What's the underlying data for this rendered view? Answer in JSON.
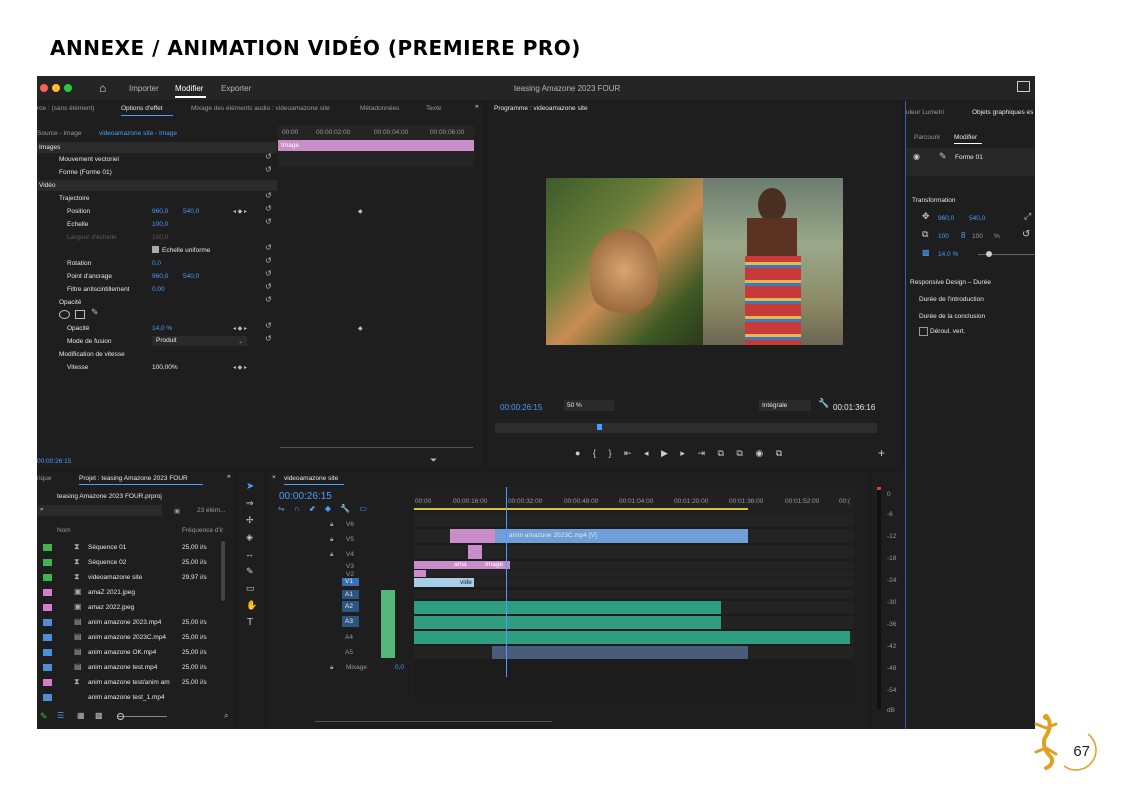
{
  "page": {
    "heading": "ANNEXE / ANIMATION VIDÉO (PREMIERE PRO)",
    "page_number": "67"
  },
  "app": {
    "title": "teasing Amazone 2023 FOUR",
    "menu": [
      "Importer",
      "Modifier",
      "Exporter"
    ],
    "active_menu": "Modifier"
  },
  "source_panel": {
    "tabs": [
      "rce : (sans élément)",
      "Options d'effet",
      "Mixage des éléments audio : videoamazone site",
      "Métadonnées",
      "Texte"
    ],
    "active_tab": "Options d'effet",
    "source_label": "Source - Image",
    "sequence_label": "videoamazone site - Image",
    "ruler": [
      "00:00",
      "00:00:02:00",
      "00:00:04:00",
      "00:00:06:00"
    ],
    "clip_label": "Image",
    "section_images": "Images",
    "section_video": "Vidéo",
    "rows": [
      {
        "label": "Mouvement vectoriel"
      },
      {
        "label": "Forme (Forme 01)"
      },
      {
        "label": "Trajectoire"
      },
      {
        "label": "Position",
        "v1": "960,0",
        "v2": "540,0"
      },
      {
        "label": "Echelle",
        "v1": "100,0"
      },
      {
        "label": "Largeur d'échelle",
        "v1": "100,0"
      },
      {
        "label": "Echelle uniforme"
      },
      {
        "label": "Rotation",
        "v1": "0,0"
      },
      {
        "label": "Point d'ancrage",
        "v1": "960,0",
        "v2": "540,0"
      },
      {
        "label": "Filtre antiscintillement",
        "v1": "0,00"
      },
      {
        "label": "Opacité"
      },
      {
        "label": "Opacité",
        "v1": "14,0 %"
      },
      {
        "label": "Mode de fusion",
        "v1": "Produit"
      },
      {
        "label": "Modification de vitesse"
      },
      {
        "label": "Vitesse",
        "v1": "100,00%"
      }
    ],
    "timecode": "00:00:26:15"
  },
  "program_monitor": {
    "title": "Programme : videoamazone site",
    "timecode": "00:00:26:15",
    "zoom": "50 %",
    "quality": "Intégrale",
    "duration": "00:01:36:16"
  },
  "right_panel": {
    "tabs": [
      "uleur Lumetri",
      "Objets graphiques es"
    ],
    "subtabs": [
      "Parcourir",
      "Modifier"
    ],
    "layer": "Forme 01",
    "transformation": "Transformation",
    "pos_x": "960,0",
    "pos_y": "540,0",
    "scale": "100",
    "scale2": "100",
    "pct": "%",
    "opacity": "14,0 %",
    "responsive": "Responsive Design – Durée",
    "intro": "Durée de l'introduction",
    "conclusion": "Durée de la conclusion",
    "scroll": "Déroul. vert."
  },
  "project_panel": {
    "tabs": [
      "rique",
      "Projet : teasing Amazone 2023 FOUR"
    ],
    "file": "teasing Amazone 2023 FOUR.prproj",
    "count": "23 élém...",
    "col_name": "Nom",
    "col_rate": "Fréquence d'ir",
    "items": [
      {
        "name": "Séquence 01",
        "rate": "25,00 i/s",
        "color": "#3fb54a"
      },
      {
        "name": "Séquence 02",
        "rate": "25,00 i/s",
        "color": "#3fb54a"
      },
      {
        "name": "videoamazone site",
        "rate": "29,97 i/s",
        "color": "#3fb54a"
      },
      {
        "name": "amaZ 2021.jpeg",
        "rate": "",
        "color": "#d47ec9"
      },
      {
        "name": "amaz 2022.jpeg",
        "rate": "",
        "color": "#d47ec9"
      },
      {
        "name": "anim amazone 2023.mp4",
        "rate": "25,00 i/s",
        "color": "#4a8fd8"
      },
      {
        "name": "anim amazone 2023C.mp4",
        "rate": "25,00 i/s",
        "color": "#4a8fd8"
      },
      {
        "name": "anim amazone OK.mp4",
        "rate": "25,00 i/s",
        "color": "#4a8fd8"
      },
      {
        "name": "anim amazone test.mp4",
        "rate": "25,00 i/s",
        "color": "#4a8fd8"
      },
      {
        "name": "anim amazone test/anim am",
        "rate": "25,00 i/s",
        "color": "#d47ec9"
      },
      {
        "name": "anim amazone test_1.mp4",
        "rate": "",
        "color": "#4a8fd8"
      }
    ]
  },
  "timeline": {
    "tab": "videoamazone site",
    "timecode": "00:00:26:15",
    "ruler": [
      "00:00",
      "00:00:16:00",
      "00:00:32:00",
      "00:00:48:00",
      "00:01:04:00",
      "00:01:20:00",
      "00:01:36:00",
      "00:01:52:00",
      "00:("
    ],
    "video_tracks": [
      "V6",
      "V5",
      "V4",
      "V3",
      "V2",
      "V1"
    ],
    "audio_tracks": [
      "A1",
      "A2",
      "A3",
      "A4",
      "A5"
    ],
    "mix_label": "Mixage",
    "mix_value": "0,0",
    "clip_main": "anim amazone 2023C.mp4 [V]",
    "clip_ama": "ama",
    "clip_image": "Image",
    "clip_vide": "vide",
    "meter_ticks": [
      "0",
      "-6",
      "-12",
      "-18",
      "-24",
      "-30",
      "-36",
      "-42",
      "-48",
      "-54",
      "dB"
    ]
  }
}
